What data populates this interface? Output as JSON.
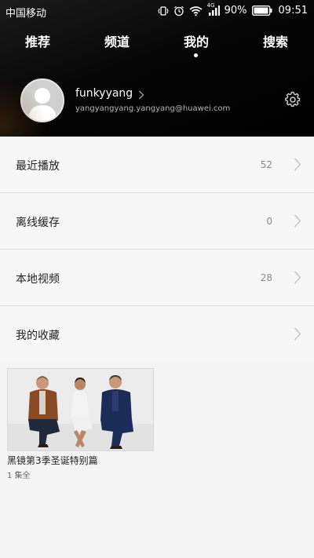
{
  "status": {
    "carrier": "中国移动",
    "network": "4G",
    "battery": "90%",
    "time": "09:51"
  },
  "tabs": [
    {
      "label": "推荐",
      "active": false
    },
    {
      "label": "频道",
      "active": false
    },
    {
      "label": "我的",
      "active": true
    },
    {
      "label": "搜索",
      "active": false
    }
  ],
  "profile": {
    "username": "funkyyang",
    "email": "yangyangyang.yangyang@huawei.com"
  },
  "menu": [
    {
      "label": "最近播放",
      "count": "52"
    },
    {
      "label": "离线缓存",
      "count": "0"
    },
    {
      "label": "本地视频",
      "count": "28"
    },
    {
      "label": "我的收藏",
      "count": ""
    }
  ],
  "favorites": [
    {
      "title": "黑镜第3季圣诞特别篇",
      "subtitle": "1 集全"
    }
  ],
  "colors": {
    "header_bg": "#000000",
    "page_bg": "#f4f4f4",
    "divider": "#e1e1e1"
  }
}
